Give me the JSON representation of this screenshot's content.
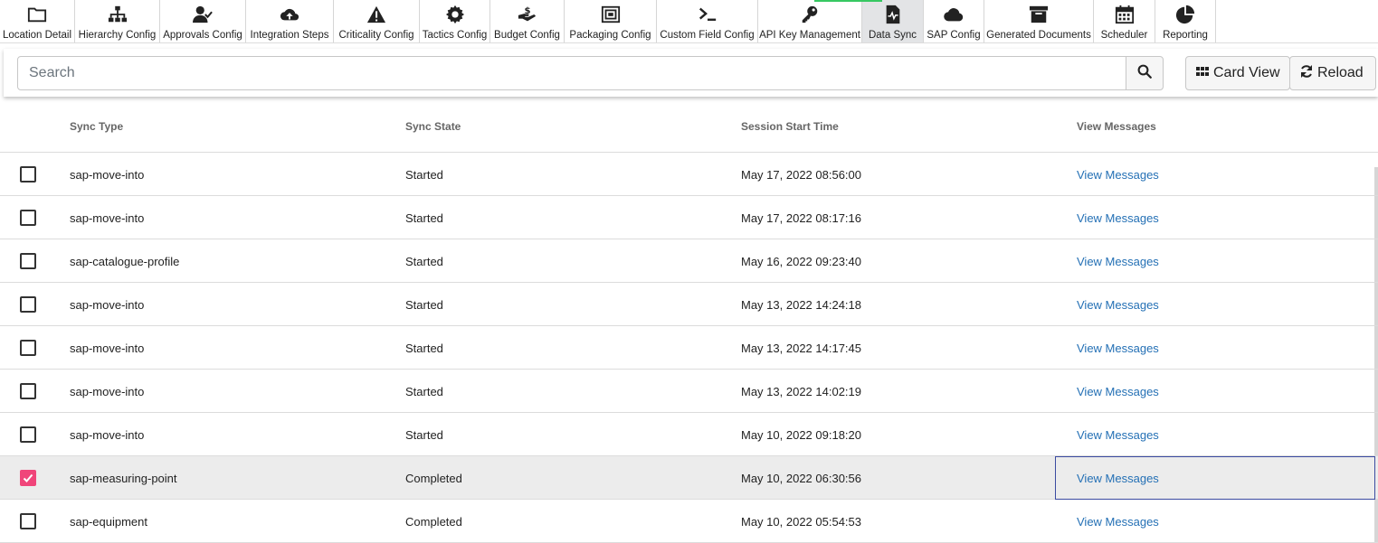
{
  "toolbar": {
    "active_index": 11,
    "accent_color": "#37c862",
    "tabs": [
      {
        "label": "Location Detail",
        "icon": "folder-icon"
      },
      {
        "label": "Hierarchy Config",
        "icon": "sitemap-icon"
      },
      {
        "label": "Approvals Config",
        "icon": "user-check-icon"
      },
      {
        "label": "Integration Steps",
        "icon": "cloud-upload-icon"
      },
      {
        "label": "Criticality Config",
        "icon": "warning-icon"
      },
      {
        "label": "Tactics Config",
        "icon": "gear-icon"
      },
      {
        "label": "Budget Config",
        "icon": "hand-dollar-icon"
      },
      {
        "label": "Packaging Config",
        "icon": "package-icon"
      },
      {
        "label": "Custom Field Config",
        "icon": "terminal-icon"
      },
      {
        "label": "API Key Management",
        "icon": "key-icon"
      },
      {
        "label": "Data Sync",
        "icon": "file-pulse-icon"
      },
      {
        "label": "SAP Config",
        "icon": "cloud-icon"
      },
      {
        "label": "Generated Documents",
        "icon": "archive-icon"
      },
      {
        "label": "Scheduler",
        "icon": "calendar-icon"
      },
      {
        "label": "Reporting",
        "icon": "pie-chart-icon"
      }
    ]
  },
  "search": {
    "placeholder": "Search",
    "value": "",
    "card_view_label": "Card View",
    "reload_label": "Reload"
  },
  "table": {
    "columns": [
      "Sync Type",
      "Sync State",
      "Session Start Time",
      "View Messages"
    ],
    "link_label": "View Messages",
    "checkbox_color": "#f0457a",
    "link_color": "#2470b5",
    "rows": [
      {
        "sync_type": "sap-move-into",
        "sync_state": "Started",
        "start_time": "May 17, 2022 08:56:00",
        "checked": false
      },
      {
        "sync_type": "sap-move-into",
        "sync_state": "Started",
        "start_time": "May 17, 2022 08:17:16",
        "checked": false
      },
      {
        "sync_type": "sap-catalogue-profile",
        "sync_state": "Started",
        "start_time": "May 16, 2022 09:23:40",
        "checked": false
      },
      {
        "sync_type": "sap-move-into",
        "sync_state": "Started",
        "start_time": "May 13, 2022 14:24:18",
        "checked": false
      },
      {
        "sync_type": "sap-move-into",
        "sync_state": "Started",
        "start_time": "May 13, 2022 14:17:45",
        "checked": false
      },
      {
        "sync_type": "sap-move-into",
        "sync_state": "Started",
        "start_time": "May 13, 2022 14:02:19",
        "checked": false
      },
      {
        "sync_type": "sap-move-into",
        "sync_state": "Started",
        "start_time": "May 10, 2022 09:18:20",
        "checked": false
      },
      {
        "sync_type": "sap-measuring-point",
        "sync_state": "Completed",
        "start_time": "May 10, 2022 06:30:56",
        "checked": true
      },
      {
        "sync_type": "sap-equipment",
        "sync_state": "Completed",
        "start_time": "May 10, 2022 05:54:53",
        "checked": false
      }
    ]
  }
}
